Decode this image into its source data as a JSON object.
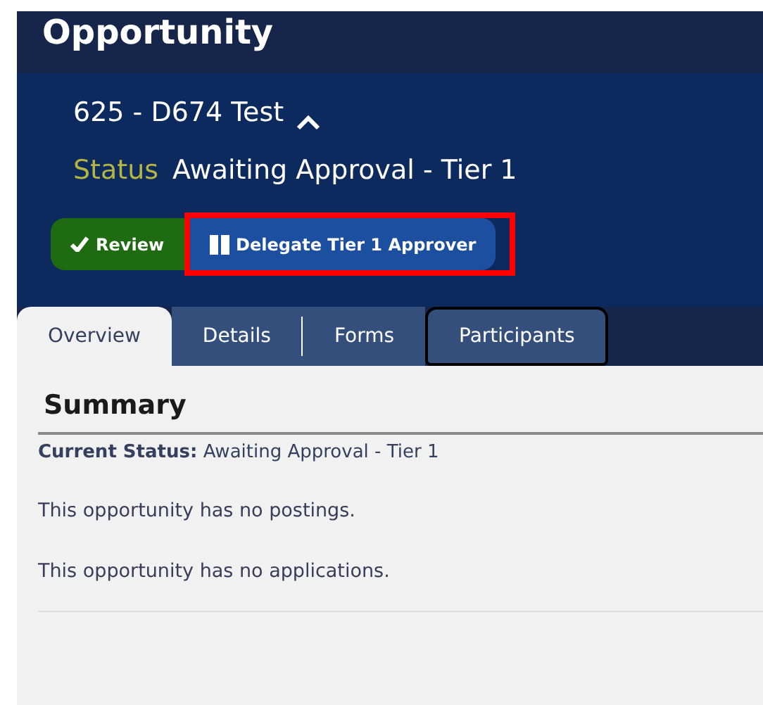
{
  "header": {
    "title": "Opportunity"
  },
  "record": {
    "name": "625 - D674 Test",
    "expanded": true,
    "status_label": "Status",
    "status_value": "Awaiting Approval - Tier 1"
  },
  "actions": [
    {
      "label": "Review",
      "kind": "review",
      "highlighted": false
    },
    {
      "label": "Delegate Tier 1 Approver",
      "kind": "delegate",
      "highlighted": true
    }
  ],
  "tabs": [
    {
      "label": "Overview",
      "selected": true,
      "focused": false
    },
    {
      "label": "Details",
      "selected": false,
      "focused": false
    },
    {
      "label": "Forms",
      "selected": false,
      "focused": false
    },
    {
      "label": "Participants",
      "selected": false,
      "focused": true
    }
  ],
  "summary": {
    "title": "Summary",
    "current_status": "**Current Status:** Awaiting Approval - Tier 1",
    "lines": [
      "This opportunity has no postings.",
      "This opportunity has no applications."
    ]
  }
}
